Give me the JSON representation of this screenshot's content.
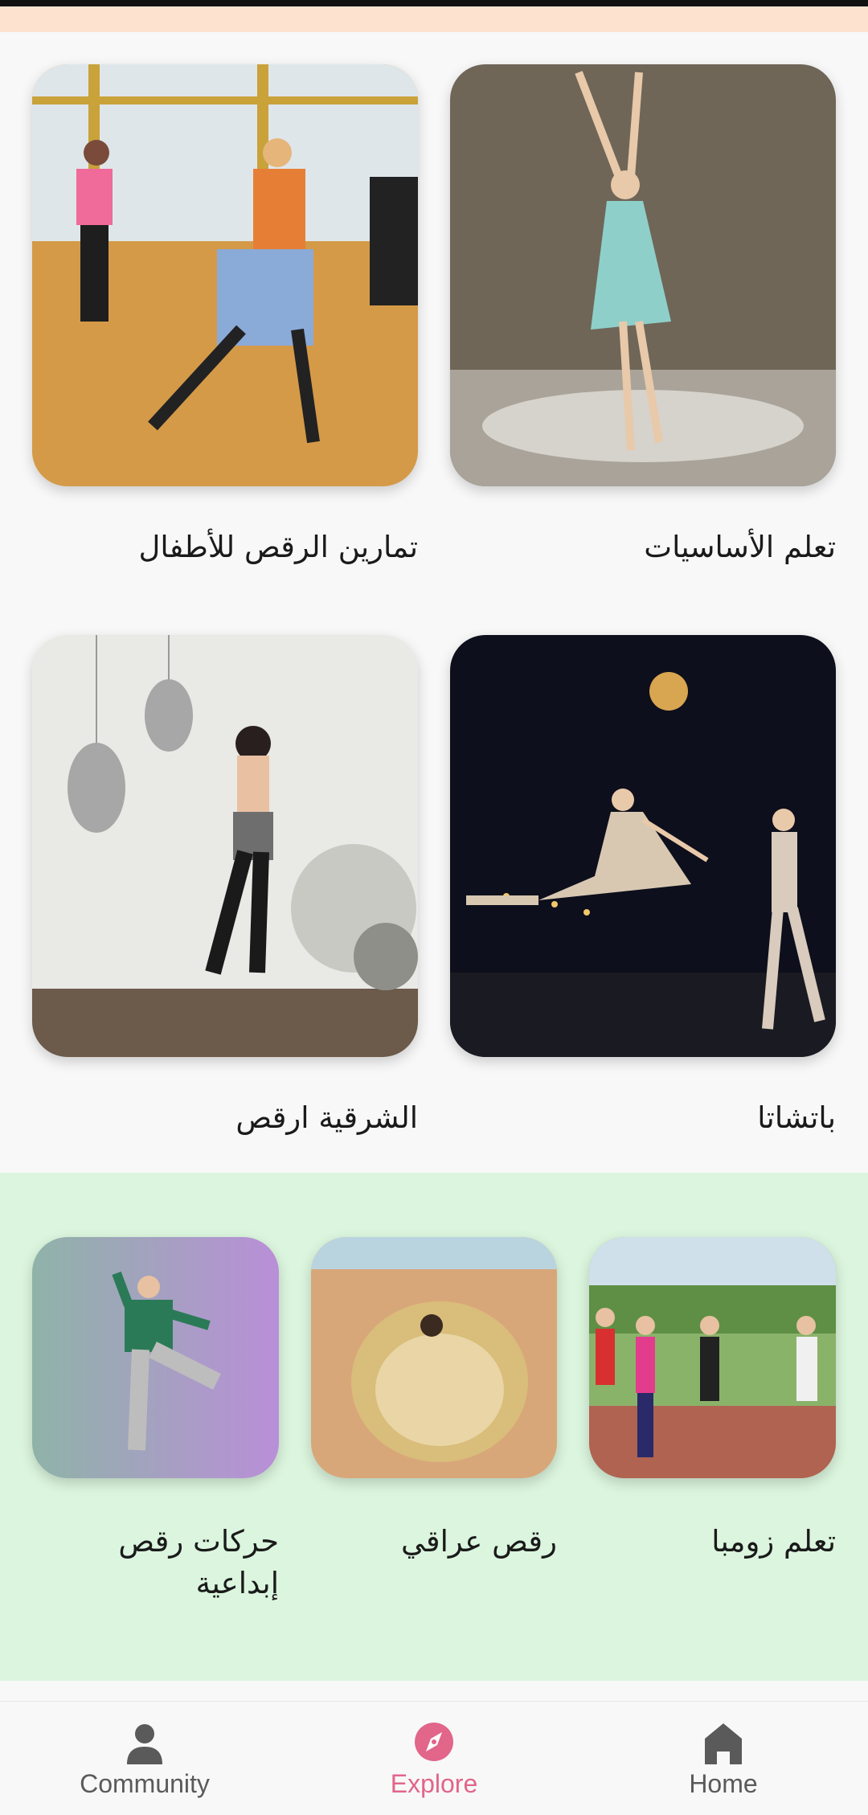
{
  "colors": {
    "accent_bar": "#fde3cf",
    "section_background": "#dbf5de",
    "nav_active": "#e2658a",
    "nav_inactive": "#5a5a5a"
  },
  "grid_cards": [
    {
      "label": "تعلم الأساسيات",
      "image": "ballet-dancer-blue-dress"
    },
    {
      "label": "تمارين الرقص للأطفال",
      "image": "dance-class-studio"
    },
    {
      "label": "باتشاتا",
      "image": "couple-dance-stage"
    },
    {
      "label": "الشرقية ارقص",
      "image": "belly-dancer-lanterns"
    }
  ],
  "carousel_cards": [
    {
      "label": "تعلم زومبا",
      "image": "zumba-group-outdoor"
    },
    {
      "label": "رقص عراقي",
      "image": "dancer-desert-gold-dress"
    },
    {
      "label": "حركات رقص إبداعية",
      "image": "hiphop-dancer-purple"
    }
  ],
  "bottom_nav": [
    {
      "label": "Community",
      "icon": "person-icon",
      "active": false
    },
    {
      "label": "Explore",
      "icon": "compass-icon",
      "active": true
    },
    {
      "label": "Home",
      "icon": "home-icon",
      "active": false
    }
  ]
}
